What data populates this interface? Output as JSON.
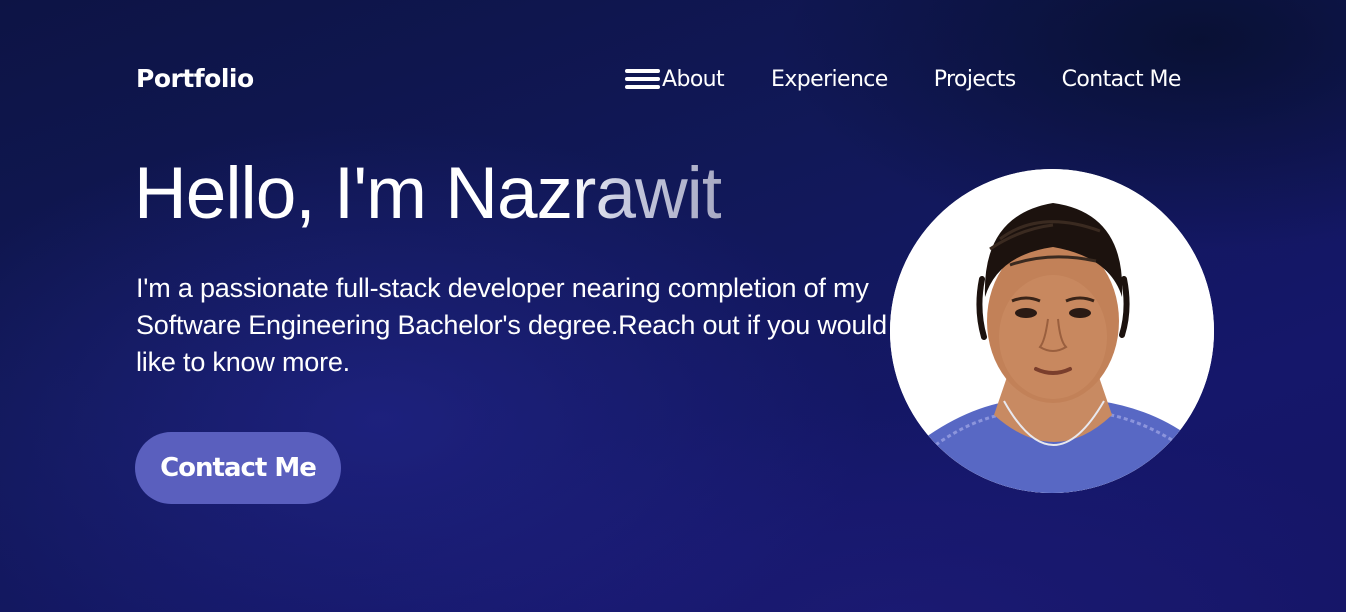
{
  "header": {
    "logo": "Portfolio",
    "nav": [
      "About",
      "Experience",
      "Projects",
      "Contact Me"
    ]
  },
  "hero": {
    "title_typed": "Hello, I'm Naz",
    "title_fading": "rawit",
    "description": "I'm a passionate full-stack developer nearing completion of my Software Engineering Bachelor's degree.Reach out if you would like to know more.",
    "cta_label": "Contact Me"
  },
  "colors": {
    "background": "#111858",
    "button": "#5a5fbe",
    "text": "#ffffff"
  },
  "icons": [
    "hamburger-menu-icon"
  ]
}
